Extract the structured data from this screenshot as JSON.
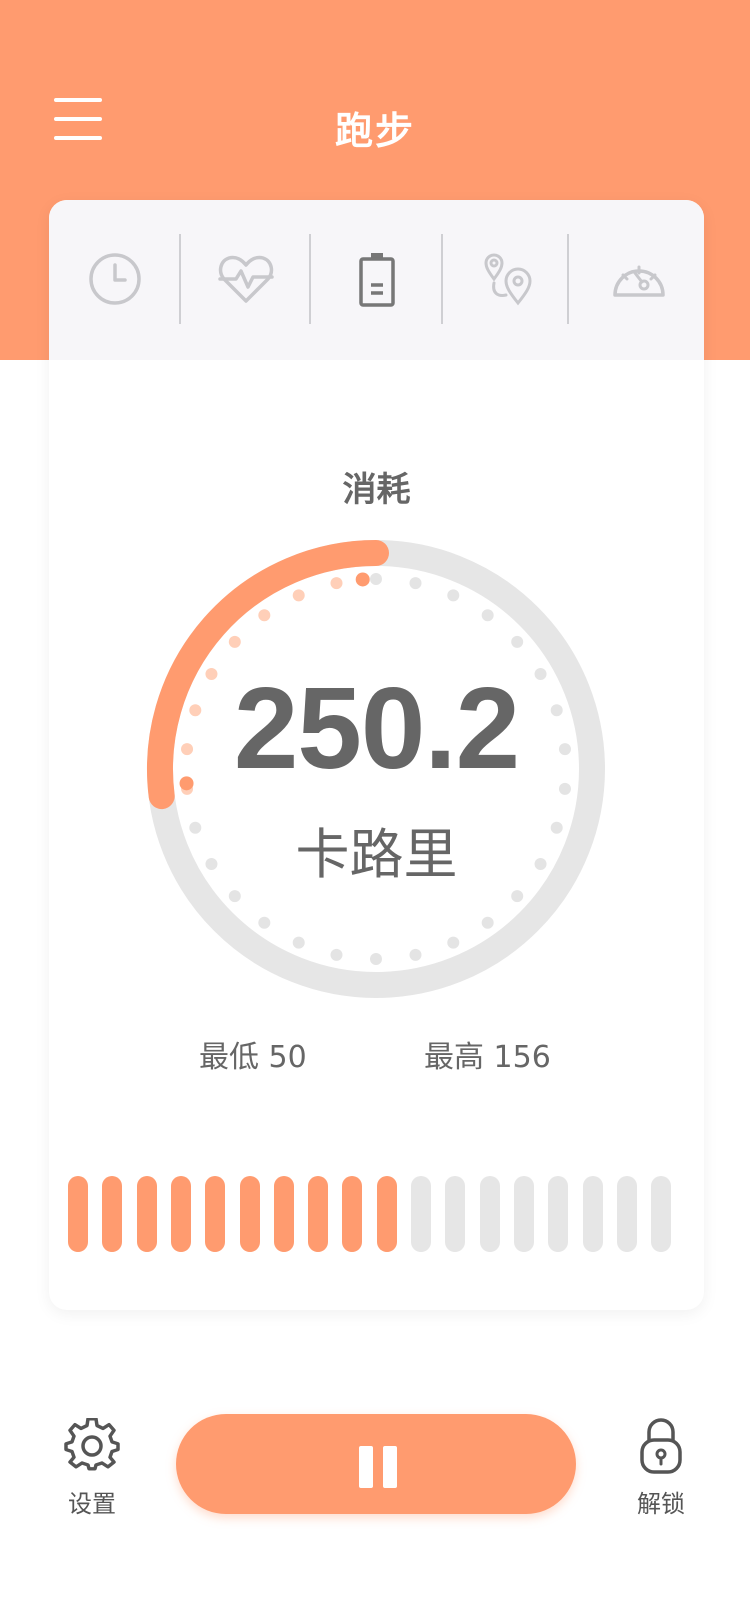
{
  "header": {
    "title": "跑步",
    "menu_icon": "hamburger-menu-icon",
    "background_color": "#ff9b6f"
  },
  "tabs": [
    {
      "icon": "clock-icon",
      "active": false
    },
    {
      "icon": "heartbeat-icon",
      "active": false
    },
    {
      "icon": "battery-icon",
      "active": true
    },
    {
      "icon": "location-route-icon",
      "active": false
    },
    {
      "icon": "speedometer-icon",
      "active": false
    }
  ],
  "metric": {
    "label": "消耗",
    "value": "250.2",
    "unit": "卡路里",
    "progress_fraction": 0.27,
    "min_label": "最低 50",
    "max_label": "最高 156"
  },
  "bars": {
    "total": 18,
    "filled": 10
  },
  "colors": {
    "accent": "#ff9b6f",
    "track": "#e6e6e6",
    "text": "#666666",
    "tab_bg": "#f7f6f9"
  },
  "footer": {
    "settings_label": "设置",
    "settings_icon": "gear-icon",
    "pause_icon": "pause-icon",
    "unlock_label": "解锁",
    "unlock_icon": "lock-icon"
  }
}
